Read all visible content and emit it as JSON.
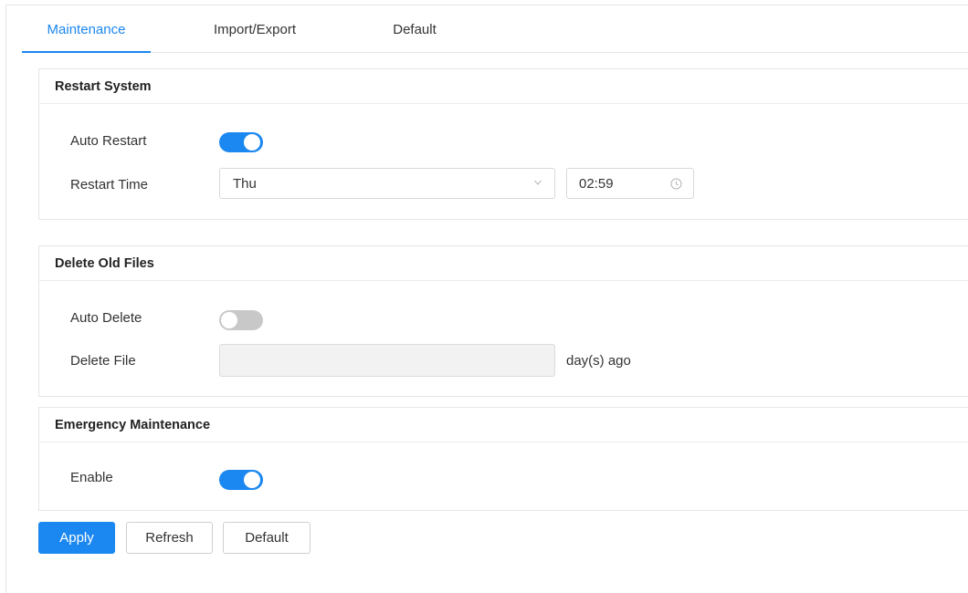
{
  "tabs": [
    {
      "label": "Maintenance",
      "active": true
    },
    {
      "label": "Import/Export",
      "active": false
    },
    {
      "label": "Default",
      "active": false
    }
  ],
  "restart_system": {
    "title": "Restart System",
    "auto_restart_label": "Auto Restart",
    "auto_restart_enabled": true,
    "restart_time_label": "Restart Time",
    "day_value": "Thu",
    "time_value": "02:59"
  },
  "delete_old_files": {
    "title": "Delete Old Files",
    "auto_delete_label": "Auto Delete",
    "auto_delete_enabled": false,
    "delete_file_label": "Delete File",
    "delete_file_value": "",
    "unit_label": "day(s) ago"
  },
  "emergency_maintenance": {
    "title": "Emergency Maintenance",
    "enable_label": "Enable",
    "enabled": true
  },
  "buttons": {
    "apply": "Apply",
    "refresh": "Refresh",
    "default": "Default"
  },
  "colors": {
    "accent": "#1b87f0",
    "switch_off": "#c8c8c8",
    "disabled_bg": "#f2f2f2"
  },
  "icons": {
    "select_arrow": "chevron-down-icon",
    "time_picker": "clock-icon"
  }
}
